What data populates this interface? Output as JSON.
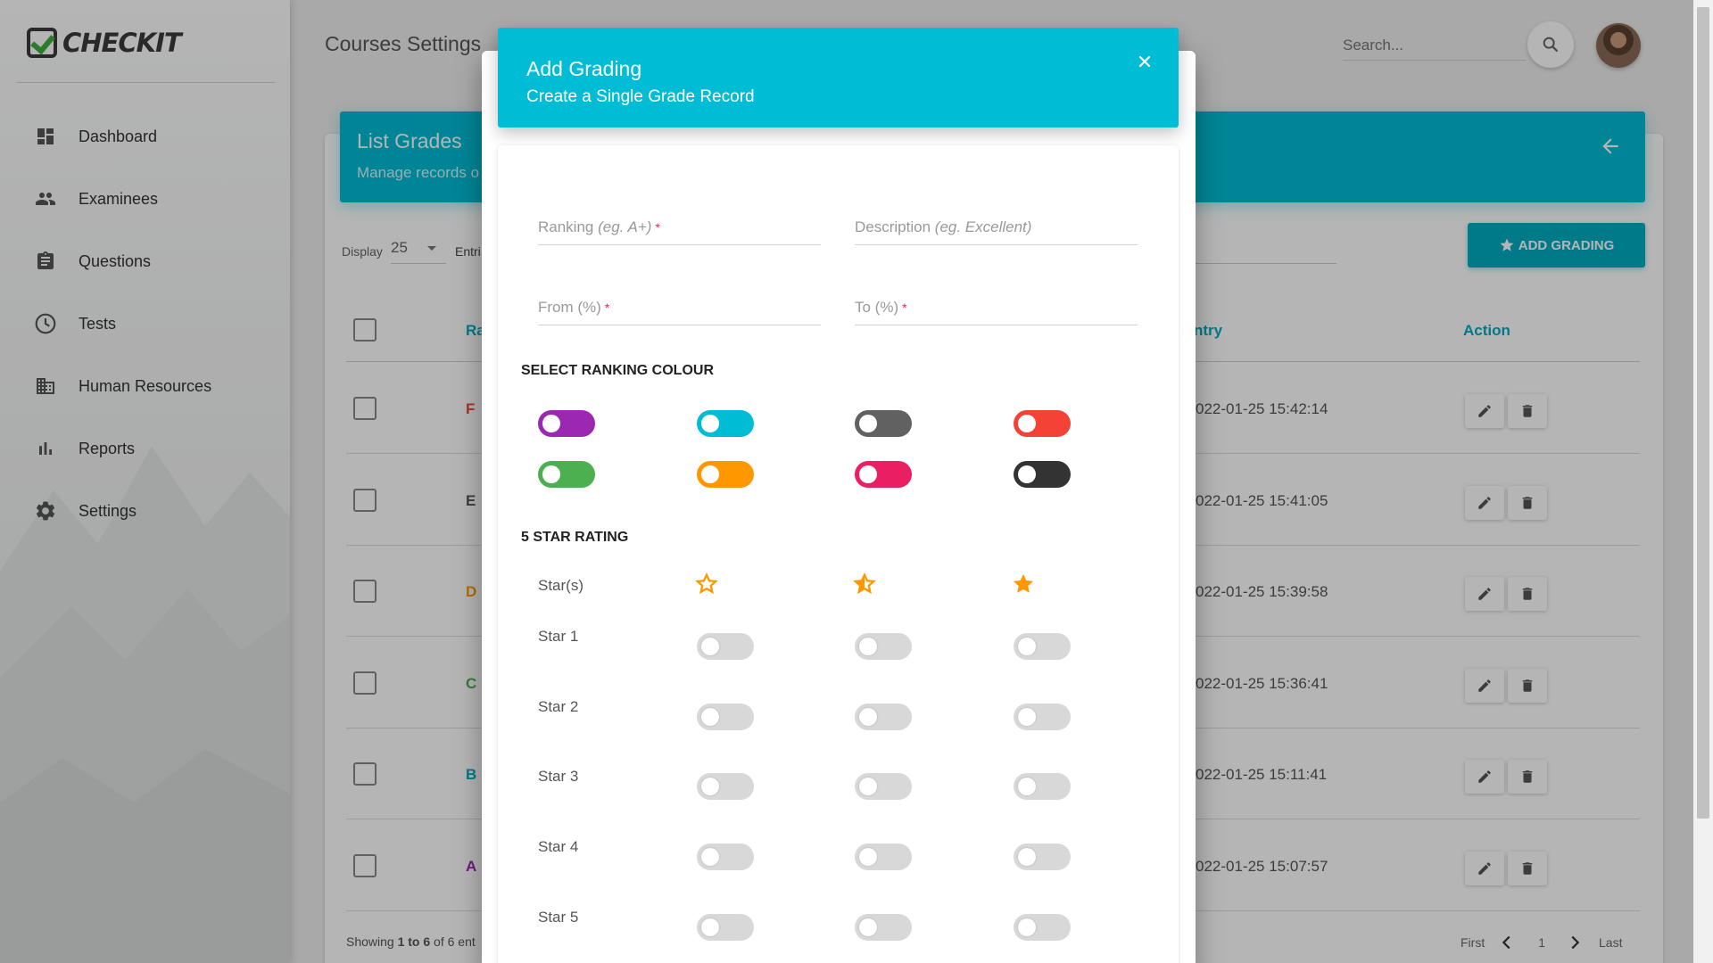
{
  "app": {
    "logo_text": "CHECKIT"
  },
  "sidebar": {
    "items": [
      {
        "label": "Dashboard",
        "icon": "dashboard-icon"
      },
      {
        "label": "Examinees",
        "icon": "people-icon"
      },
      {
        "label": "Questions",
        "icon": "clipboard-icon"
      },
      {
        "label": "Tests",
        "icon": "clock-icon"
      },
      {
        "label": "Human Resources",
        "icon": "building-icon"
      },
      {
        "label": "Reports",
        "icon": "bar-chart-icon"
      },
      {
        "label": "Settings",
        "icon": "gear-icon"
      }
    ]
  },
  "header": {
    "page_title": "Courses Settings",
    "search_placeholder": "Search..."
  },
  "card": {
    "title": "List Grades",
    "subtitle": "Manage records o",
    "add_button": "ADD GRADING",
    "display_label": "Display",
    "display_value": "25",
    "entries_label": "Entri",
    "columns": {
      "ranking": "Ra",
      "entry": "ntry",
      "action": "Action"
    },
    "rows": [
      {
        "rank": "F",
        "date": "022-01-25 15:42:14",
        "color": "#f44336"
      },
      {
        "rank": "E",
        "date": "022-01-25 15:41:05",
        "color": "#555555"
      },
      {
        "rank": "D",
        "date": "022-01-25 15:39:58",
        "color": "#ff9800"
      },
      {
        "rank": "C",
        "date": "022-01-25 15:36:41",
        "color": "#4caf50"
      },
      {
        "rank": "B",
        "date": "022-01-25 15:11:41",
        "color": "#00acc1"
      },
      {
        "rank": "A",
        "date": "022-01-25 15:07:57",
        "color": "#9c27b0"
      }
    ],
    "showing_prefix": "Showing ",
    "showing_range": "1 to 6",
    "showing_suffix": " of 6 ent",
    "pager": {
      "first": "First",
      "page": "1",
      "last": "Last"
    }
  },
  "modal": {
    "title": "Add Grading",
    "subtitle": "Create a Single Grade Record",
    "fields": {
      "ranking_label": "Ranking",
      "ranking_hint": "(eg. A+)",
      "description_label": "Description",
      "description_hint": "(eg. Excellent)",
      "from_label": "From (%)",
      "to_label": "To (%)",
      "required_mark": "*"
    },
    "colour_section": "SELECT RANKING COLOUR",
    "colours": [
      "#9c27b0",
      "#00bcd4",
      "#616161",
      "#f44336",
      "#4caf50",
      "#ff9800",
      "#e91e63",
      "#333333"
    ],
    "star_section": "5 STAR RATING",
    "star_header": "Star(s)",
    "star_types": [
      "star-outline-icon",
      "star-half-icon",
      "star-full-icon"
    ],
    "star_rows": [
      "Star 1",
      "Star 2",
      "Star 3",
      "Star 4",
      "Star 5"
    ],
    "accent": "#00bcd4",
    "star_color": "#ff9800"
  }
}
